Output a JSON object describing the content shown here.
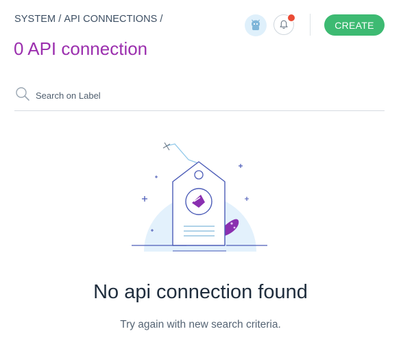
{
  "header": {
    "breadcrumb": [
      "SYSTEM",
      "API CONNECTIONS"
    ],
    "separator": "/",
    "title": "0 API connection",
    "create_label": "CREATE",
    "avatar_icon": "user-avatar-icon",
    "bell_icon": "bell-icon",
    "notification_dot_color": "#ea4b35",
    "accent_color": "#9b2fae",
    "create_color": "#3dba72"
  },
  "search": {
    "placeholder": "Search on Label",
    "value": "",
    "icon": "search-icon"
  },
  "empty_state": {
    "illustration": "tag-with-logo-illustration",
    "title": "No api connection found",
    "subtitle": "Try again with new search criteria."
  }
}
